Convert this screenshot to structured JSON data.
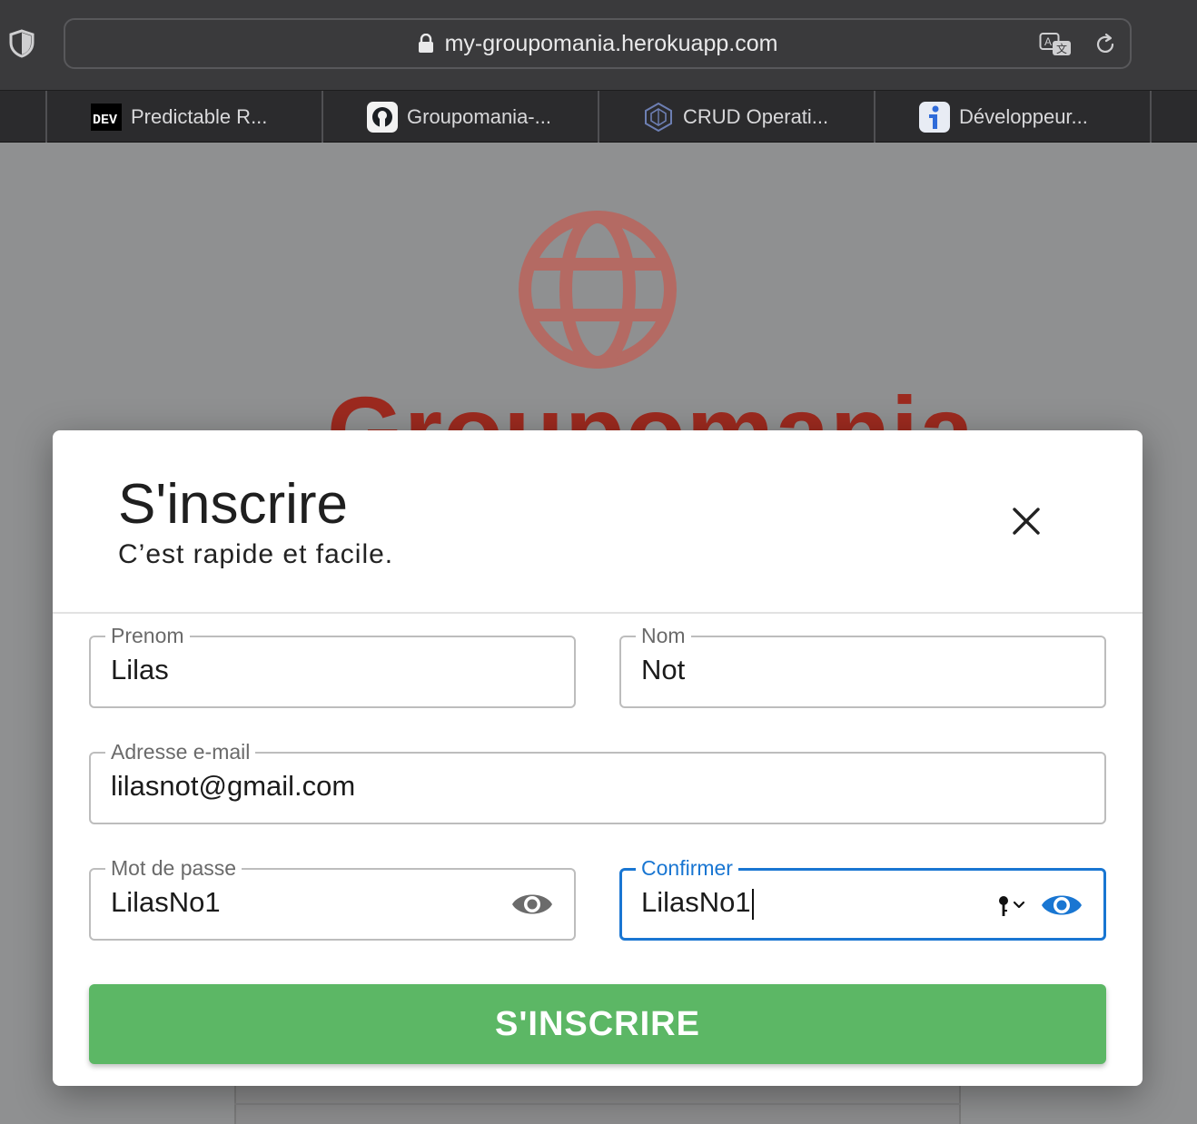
{
  "browser": {
    "url": "my-groupomania.herokuapp.com",
    "tabs": [
      {
        "label": "Predictable R...",
        "icon": "dev-icon"
      },
      {
        "label": "Groupomania-...",
        "icon": "github-icon"
      },
      {
        "label": "CRUD Operati...",
        "icon": "cube-icon"
      },
      {
        "label": "Développeur...",
        "icon": "info-icon"
      }
    ]
  },
  "page": {
    "logo_text": "Groupomania",
    "brand_color": "#9c2a1f"
  },
  "modal": {
    "title": "S'inscrire",
    "subtitle": "C’est rapide et facile.",
    "fields": {
      "prenom": {
        "label": "Prenom",
        "value": "Lilas"
      },
      "nom": {
        "label": "Nom",
        "value": "Not"
      },
      "email": {
        "label": "Adresse e-mail",
        "value": "lilasnot@gmail.com"
      },
      "password": {
        "label": "Mot de passe",
        "value": "LilasNo1"
      },
      "confirm": {
        "label": "Confirmer",
        "value": "LilasNo1"
      }
    },
    "submit_label": "S'INSCRIRE",
    "accent_color": "#1976d2",
    "submit_color": "#5cb765"
  }
}
